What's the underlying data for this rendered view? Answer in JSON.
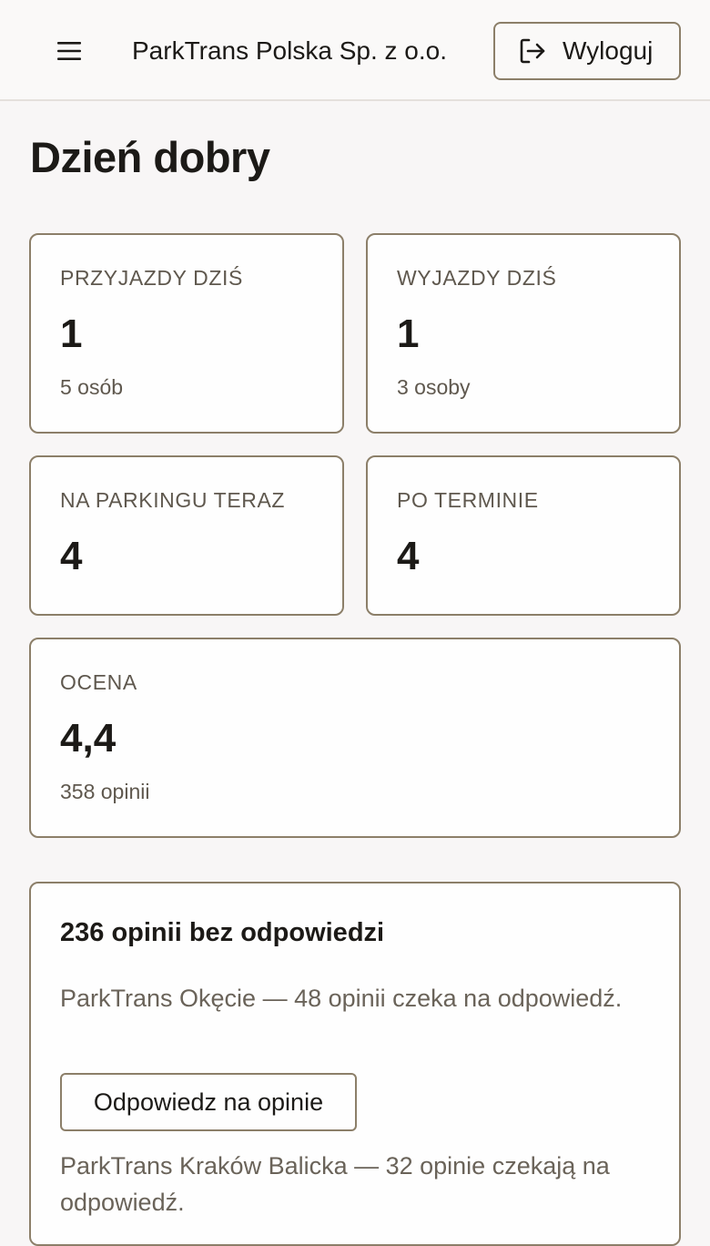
{
  "header": {
    "menu_icon": "hamburger-menu-icon",
    "company_name": "ParkTrans Polska Sp. z o.o.",
    "logout_icon": "logout-arrow-icon",
    "logout_label": "Wyloguj"
  },
  "greeting": "Dzień dobry",
  "stats": {
    "arrivals": {
      "label": "PRZYJAZDY DZIŚ",
      "value": "1",
      "sub": "5 osób"
    },
    "departures": {
      "label": "WYJAZDY DZIŚ",
      "value": "1",
      "sub": "3 osoby"
    },
    "on_parking": {
      "label": "NA PARKINGU TERAZ",
      "value": "4"
    },
    "overdue": {
      "label": "PO TERMINIE",
      "value": "4"
    },
    "rating": {
      "label": "OCENA",
      "value": "4,4",
      "sub": "358 opinii"
    }
  },
  "reviews": {
    "title": "236 opinii bez odpowiedzi",
    "locations": [
      {
        "text": "ParkTrans Okęcie — 48 opinii czeka na odpowiedź.",
        "button": "Odpowiedz na opinie"
      },
      {
        "text": "ParkTrans Kraków Balicka — 32 opinie czekają na odpowiedź."
      }
    ]
  },
  "colors": {
    "border": "#8c7f69",
    "background": "#f8f6f6",
    "text": "#1c1a17",
    "muted": "#5f584e"
  }
}
